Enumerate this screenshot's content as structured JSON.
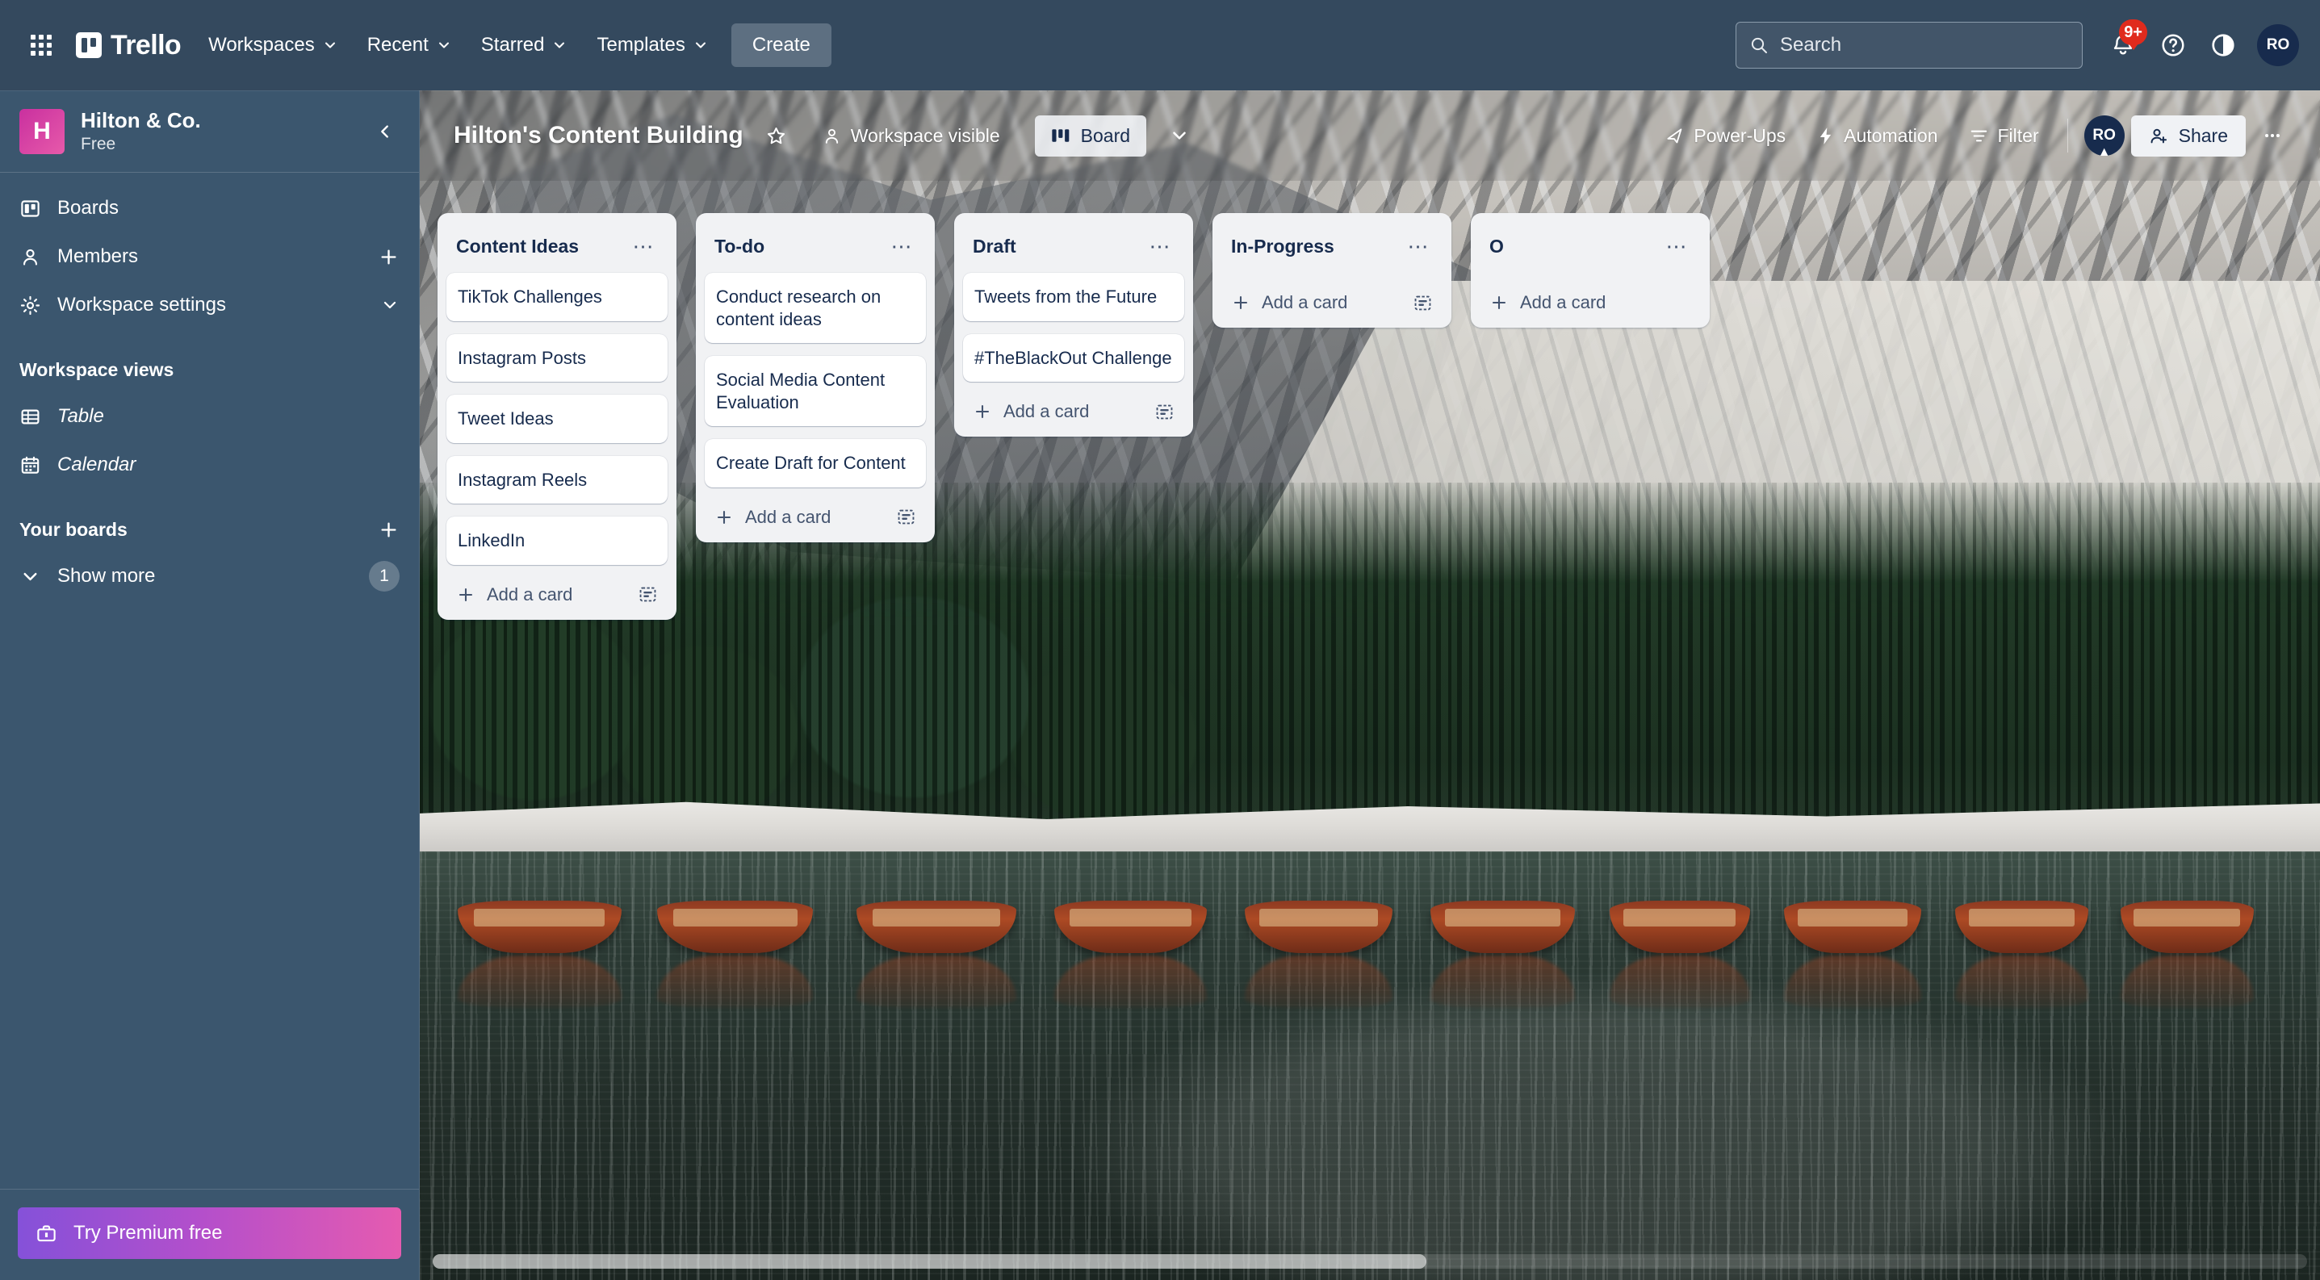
{
  "topnav": {
    "apps_icon": "apps-grid-icon",
    "logo_text": "Trello",
    "menus": [
      {
        "label": "Workspaces",
        "icon": "chevron-down-icon"
      },
      {
        "label": "Recent",
        "icon": "chevron-down-icon"
      },
      {
        "label": "Starred",
        "icon": "chevron-down-icon"
      },
      {
        "label": "Templates",
        "icon": "chevron-down-icon"
      }
    ],
    "create_label": "Create",
    "search": {
      "placeholder": "Search",
      "icon": "search-icon"
    },
    "notifications": {
      "icon": "bell-icon",
      "badge": "9+"
    },
    "help": {
      "icon": "help-circle-icon"
    },
    "theme": {
      "icon": "contrast-half-circle-icon"
    },
    "account": {
      "initials": "RO",
      "icon": "avatar"
    }
  },
  "sidebar": {
    "workspace": {
      "initial": "H",
      "name": "Hilton & Co.",
      "plan": "Free",
      "collapse_icon": "chevron-left-icon"
    },
    "nav": [
      {
        "label": "Boards",
        "icon": "board-icon",
        "tail": ""
      },
      {
        "label": "Members",
        "icon": "person-icon",
        "tail": "plus-icon"
      },
      {
        "label": "Workspace settings",
        "icon": "gear-icon",
        "tail": "chevron-down-icon"
      }
    ],
    "views_section": {
      "title": "Workspace views"
    },
    "views": [
      {
        "label": "Table",
        "icon": "table-icon"
      },
      {
        "label": "Calendar",
        "icon": "calendar-icon"
      }
    ],
    "boards_section": {
      "title": "Your boards",
      "tail": "plus-icon"
    },
    "show_more": {
      "label": "Show more",
      "icon": "chevron-down-icon",
      "count": "1"
    },
    "premium": {
      "label": "Try Premium free",
      "icon": "briefcase-icon"
    }
  },
  "board_header": {
    "title": "Hilton's Content Building",
    "star_icon": "star-icon",
    "visibility": {
      "label": "Workspace visible",
      "icon": "person-icon"
    },
    "view_switcher": {
      "label": "Board",
      "icon": "board-view-icon",
      "chevron": "chevron-down-icon"
    },
    "power_ups": {
      "label": "Power-Ups",
      "icon": "rocket-icon"
    },
    "automation": {
      "label": "Automation",
      "icon": "lightning-bolt-icon"
    },
    "filter": {
      "label": "Filter",
      "icon": "filter-icon"
    },
    "member": {
      "initials": "RO"
    },
    "share": {
      "label": "Share",
      "icon": "person-add-icon"
    },
    "more": {
      "icon": "ellipsis-icon"
    }
  },
  "board": {
    "add_card_label": "Add a card",
    "card_template_icon": "card-template-icon",
    "add_icon": "plus-icon",
    "list_menu_icon": "ellipsis-icon",
    "lists": [
      {
        "title": "Content Ideas",
        "cards": [
          "TikTok Challenges",
          "Instagram Posts",
          "Tweet Ideas",
          "Instagram Reels",
          "LinkedIn"
        ]
      },
      {
        "title": "To-do",
        "cards": [
          "Conduct research on content ideas",
          "Social Media Content Evaluation",
          "Create Draft for Content"
        ]
      },
      {
        "title": "Draft",
        "cards": [
          "Tweets from the Future",
          "#TheBlackOut Challenge"
        ]
      },
      {
        "title": "In-Progress",
        "cards": []
      },
      {
        "title": "O",
        "cards": []
      }
    ]
  },
  "colors": {
    "topnav_bg": "#34495e",
    "sidebar_bg": "#3b566e",
    "list_bg": "#f1f2f4",
    "card_bg": "#ffffff",
    "text_dark": "#172b4d",
    "badge_red": "#e02b1d",
    "workspace_avatar": "#c9309f",
    "premium_gradient_start": "#8551d9",
    "premium_gradient_end": "#e55bb0"
  }
}
